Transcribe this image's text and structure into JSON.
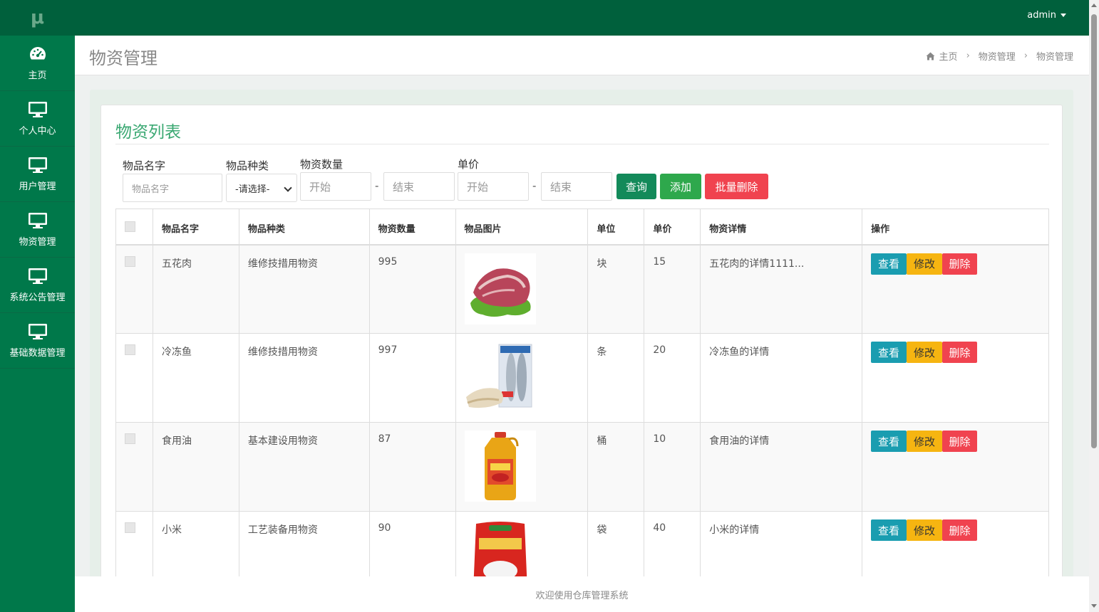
{
  "app": {
    "logo_text": "μ",
    "user_name": "admin",
    "footer_text": "欢迎使用仓库管理系统"
  },
  "sidebar": {
    "items": [
      {
        "label": "主页",
        "icon": "dashboard-icon"
      },
      {
        "label": "个人中心",
        "icon": "monitor-icon"
      },
      {
        "label": "用户管理",
        "icon": "monitor-icon"
      },
      {
        "label": "物资管理",
        "icon": "monitor-icon"
      },
      {
        "label": "系统公告管理",
        "icon": "monitor-icon"
      },
      {
        "label": "基础数据管理",
        "icon": "monitor-icon"
      }
    ]
  },
  "header": {
    "title": "物资管理",
    "breadcrumb": [
      "主页",
      "物资管理",
      "物资管理"
    ]
  },
  "panel": {
    "title": "物资列表"
  },
  "filters": {
    "name_label": "物品名字",
    "name_placeholder": "物品名字",
    "type_label": "物品种类",
    "type_selected": "-请选择-",
    "quantity_label": "物资数量",
    "quantity_start": "开始",
    "quantity_end": "结束",
    "price_label": "单价",
    "price_start": "开始",
    "price_end": "结束",
    "dash": "-",
    "query_button": "查询",
    "add_button": "添加",
    "batch_delete_button": "批量删除"
  },
  "table": {
    "columns": [
      "物品名字",
      "物品种类",
      "物资数量",
      "物品图片",
      "单位",
      "单价",
      "物资详情",
      "操作"
    ],
    "actions": {
      "view": "查看",
      "edit": "修改",
      "delete": "删除"
    },
    "rows": [
      {
        "name": "五花肉",
        "type": "维修技措用物资",
        "quantity": "995",
        "unit": "块",
        "price": "15",
        "detail": "五花肉的详情1111..."
      },
      {
        "name": "冷冻鱼",
        "type": "维修技措用物资",
        "quantity": "997",
        "unit": "条",
        "price": "20",
        "detail": "冷冻鱼的详情"
      },
      {
        "name": "食用油",
        "type": "基本建设用物资",
        "quantity": "87",
        "unit": "桶",
        "price": "10",
        "detail": "食用油的详情"
      },
      {
        "name": "小米",
        "type": "工艺装备用物资",
        "quantity": "90",
        "unit": "袋",
        "price": "40",
        "detail": "小米的详情"
      }
    ]
  },
  "colors": {
    "sidebar": "#00784a",
    "topbar": "#00603c",
    "accent_title": "#3aa872",
    "btn_view": "#1a9db0",
    "btn_edit": "#f6b511",
    "btn_delete": "#f0434f"
  }
}
